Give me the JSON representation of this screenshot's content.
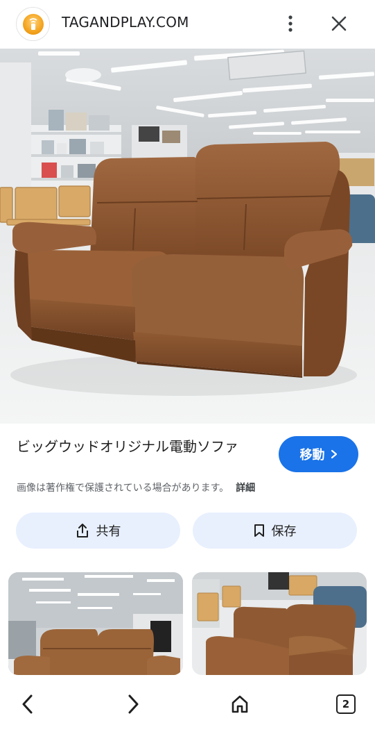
{
  "header": {
    "site_title": "TAGANDPLAY.COM",
    "site_icon": "tagandplay-logo-icon",
    "menu_icon": "more-vert-icon",
    "close_icon": "close-icon"
  },
  "result": {
    "title": "ビッグウッドオリジナル電動ソファ",
    "visit_label": "移動",
    "copyright_notice": "画像は著作権で保護されている場合があります。",
    "details_label": "詳細"
  },
  "actions": {
    "share_label": "共有",
    "save_label": "保存"
  },
  "bottom_nav": {
    "back_icon": "chevron-left-icon",
    "forward_icon": "chevron-right-icon",
    "home_icon": "home-icon",
    "tab_count": "2"
  },
  "colors": {
    "accent": "#1a73e8",
    "pill_bg": "#e8f0fe",
    "sofa_brown": "#8a5430"
  }
}
